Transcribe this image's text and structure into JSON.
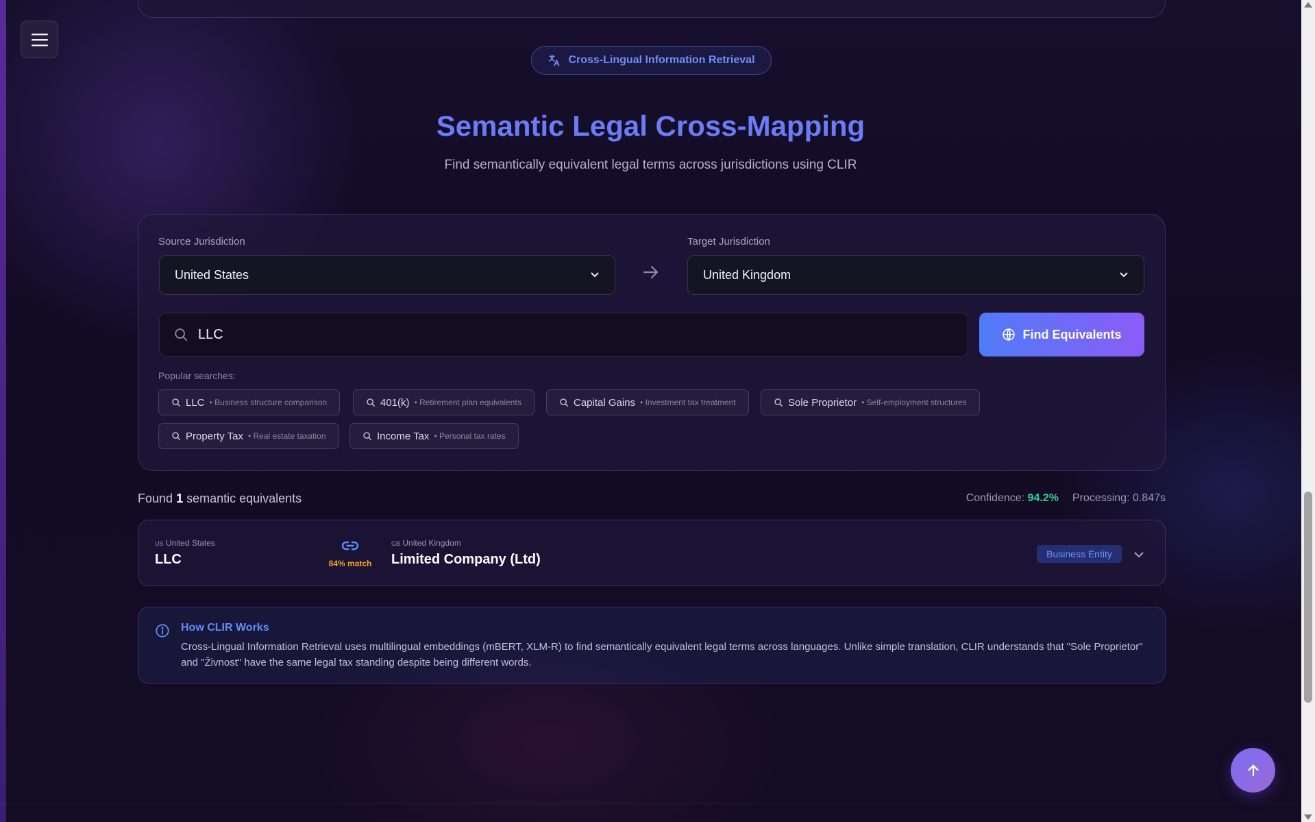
{
  "badge_pill": {
    "label": "Cross-Lingual Information Retrieval",
    "icon": "translate-icon"
  },
  "header": {
    "title": "Semantic Legal Cross-Mapping",
    "subtitle": "Find semantically equivalent legal terms across jurisdictions using CLIR"
  },
  "form": {
    "source_label": "Source Jurisdiction",
    "source_value": "United States",
    "target_label": "Target Jurisdiction",
    "target_value": "United Kingdom",
    "search_value": "LLC",
    "find_button": "Find Equivalents",
    "popular_label": "Popular searches:",
    "popular": [
      {
        "term": "LLC",
        "desc": "• Business structure comparison"
      },
      {
        "term": "401(k)",
        "desc": "• Retirement plan equivalents"
      },
      {
        "term": "Capital Gains",
        "desc": "• Investment tax treatment"
      },
      {
        "term": "Sole Proprietor",
        "desc": "• Self-employment structures"
      },
      {
        "term": "Property Tax",
        "desc": "• Real estate taxation"
      },
      {
        "term": "Income Tax",
        "desc": "• Personal tax rates"
      }
    ]
  },
  "results": {
    "found_prefix": "Found",
    "found_count": "1",
    "found_suffix": "semantic equivalents",
    "confidence_label": "Confidence:",
    "confidence_value": "94.2%",
    "processing": "Processing: 0.847s",
    "items": [
      {
        "source_flag": "US",
        "source_country": "United States",
        "source_term": "LLC",
        "match": "84% match",
        "target_flag": "GB",
        "target_country": "United Kingdom",
        "target_term": "Limited Company (Ltd)",
        "category": "Business Entity"
      }
    ]
  },
  "info": {
    "title": "How CLIR Works",
    "body": "Cross-Lingual Information Retrieval uses multilingual embeddings (mBERT, XLM-R) to find semantically equivalent legal terms across languages. Unlike simple translation, CLIR understands that \"Sole Proprietor\" and \"Živnost\" have the same legal tax standing despite being different words."
  },
  "colors": {
    "accent": "#6b7cf6",
    "confidence": "#2fd39a",
    "match": "#f5a623",
    "button_start": "#4f7bf6",
    "button_end": "#8b5cf6"
  }
}
